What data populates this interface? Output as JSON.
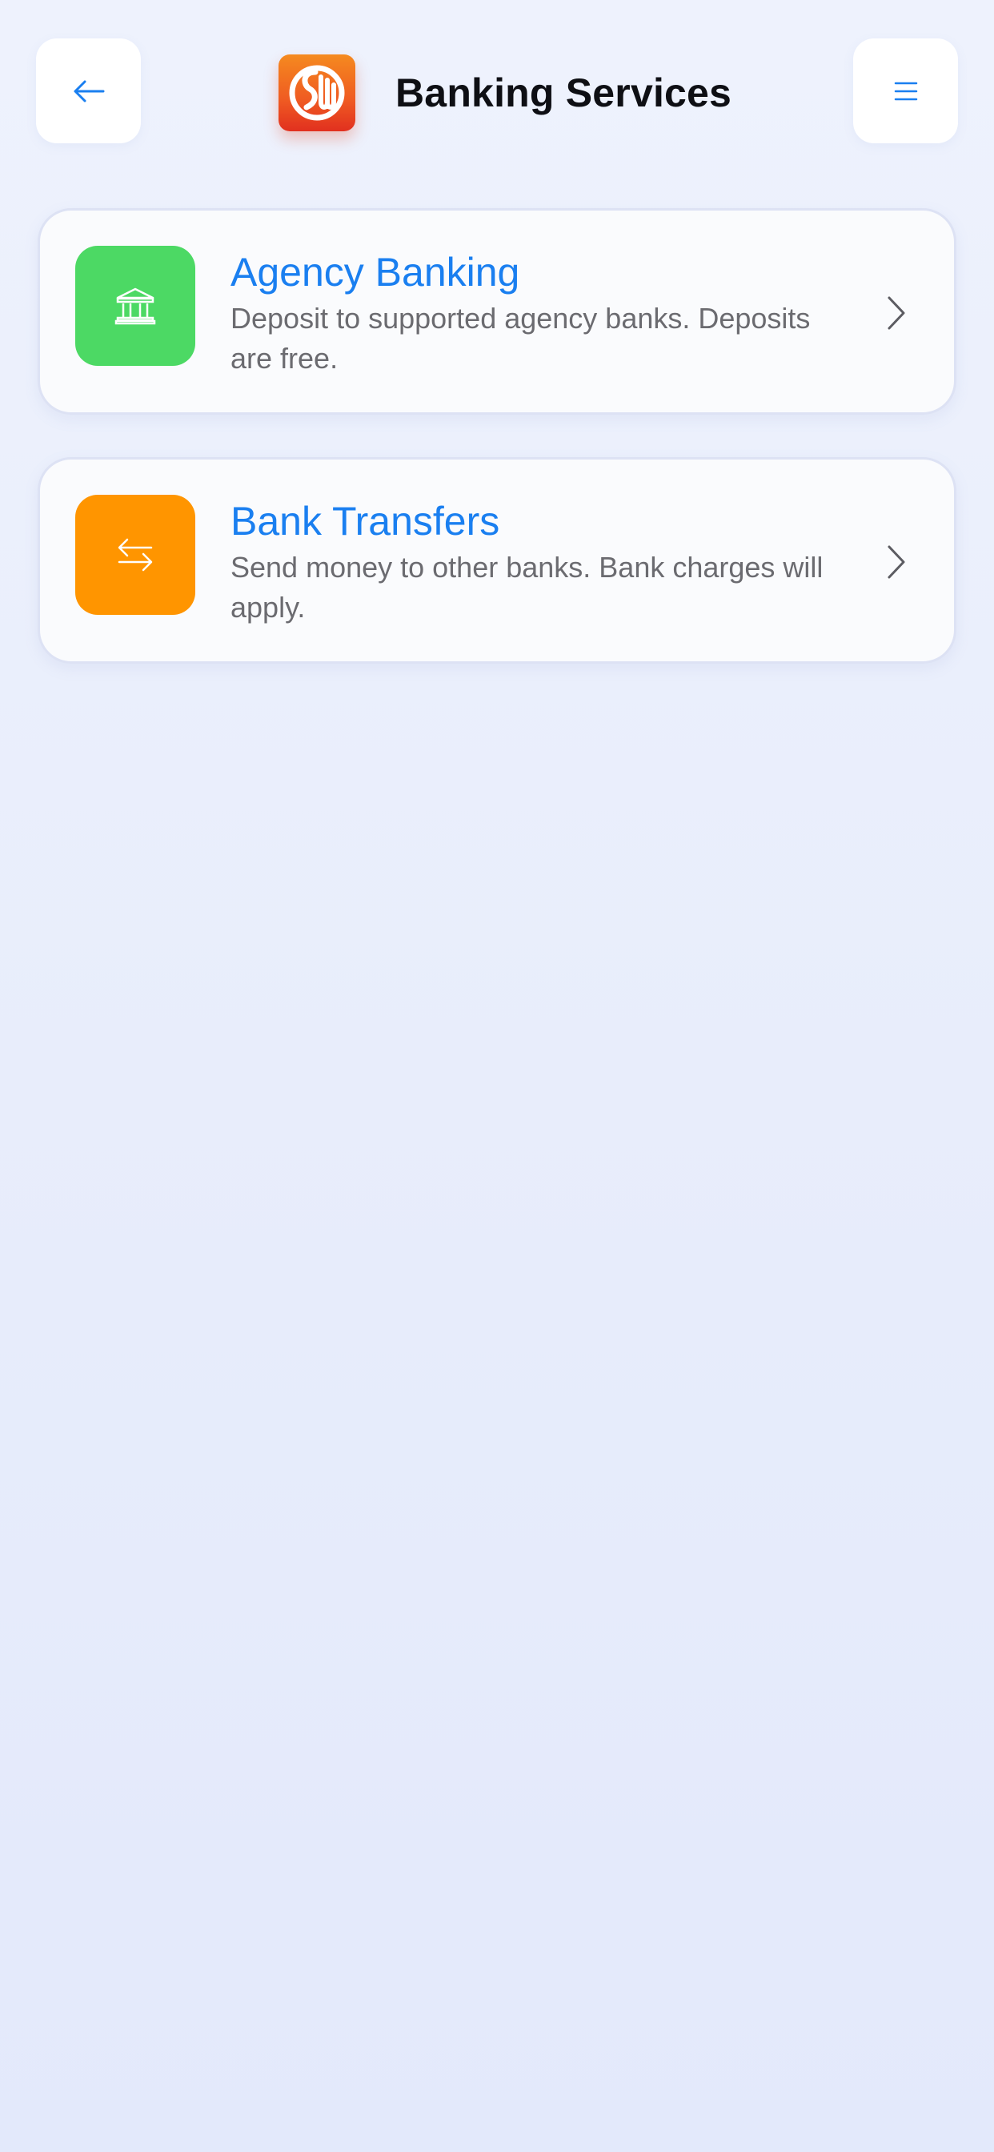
{
  "header": {
    "title": "Banking Services",
    "back_icon": "arrow-left-icon",
    "menu_icon": "hamburger-menu-icon",
    "logo": {
      "name": "app-logo",
      "lettering": "SW",
      "colors": [
        "#f58a1f",
        "#ef5a22",
        "#e1301f"
      ]
    }
  },
  "services": [
    {
      "title": "Agency Banking",
      "description": "Deposit to supported agency banks. Deposits are free.",
      "icon": "bank-building-icon",
      "color": "#4cd964"
    },
    {
      "title": "Bank Transfers",
      "description": "Send money to other banks. Bank charges will apply.",
      "icon": "transfer-arrows-icon",
      "color": "#ff9500"
    }
  ],
  "theme": {
    "accent": "#1a7ff0",
    "background": "#eaeffc",
    "card_background": "#fafbfd"
  }
}
